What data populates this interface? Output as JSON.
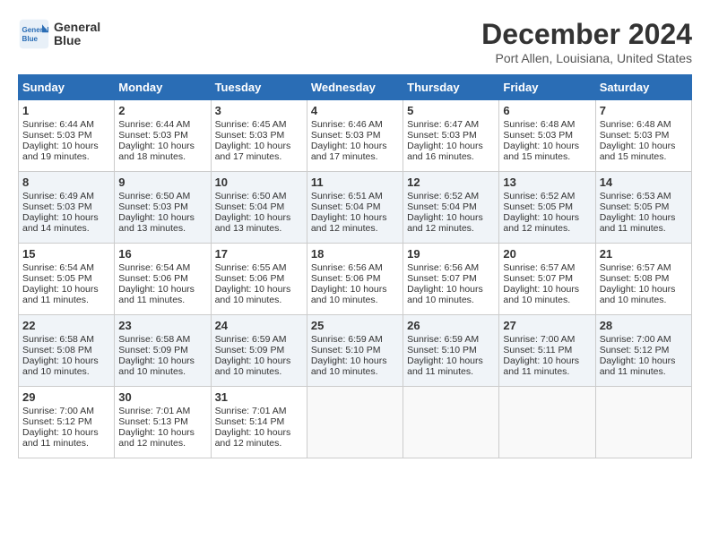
{
  "header": {
    "logo_line1": "General",
    "logo_line2": "Blue",
    "title": "December 2024",
    "subtitle": "Port Allen, Louisiana, United States"
  },
  "calendar": {
    "days_of_week": [
      "Sunday",
      "Monday",
      "Tuesday",
      "Wednesday",
      "Thursday",
      "Friday",
      "Saturday"
    ],
    "weeks": [
      [
        {
          "day": "1",
          "sunrise": "6:44 AM",
          "sunset": "5:03 PM",
          "daylight": "10 hours and 19 minutes."
        },
        {
          "day": "2",
          "sunrise": "6:44 AM",
          "sunset": "5:03 PM",
          "daylight": "10 hours and 18 minutes."
        },
        {
          "day": "3",
          "sunrise": "6:45 AM",
          "sunset": "5:03 PM",
          "daylight": "10 hours and 17 minutes."
        },
        {
          "day": "4",
          "sunrise": "6:46 AM",
          "sunset": "5:03 PM",
          "daylight": "10 hours and 17 minutes."
        },
        {
          "day": "5",
          "sunrise": "6:47 AM",
          "sunset": "5:03 PM",
          "daylight": "10 hours and 16 minutes."
        },
        {
          "day": "6",
          "sunrise": "6:48 AM",
          "sunset": "5:03 PM",
          "daylight": "10 hours and 15 minutes."
        },
        {
          "day": "7",
          "sunrise": "6:48 AM",
          "sunset": "5:03 PM",
          "daylight": "10 hours and 15 minutes."
        }
      ],
      [
        {
          "day": "8",
          "sunrise": "6:49 AM",
          "sunset": "5:03 PM",
          "daylight": "10 hours and 14 minutes."
        },
        {
          "day": "9",
          "sunrise": "6:50 AM",
          "sunset": "5:03 PM",
          "daylight": "10 hours and 13 minutes."
        },
        {
          "day": "10",
          "sunrise": "6:50 AM",
          "sunset": "5:04 PM",
          "daylight": "10 hours and 13 minutes."
        },
        {
          "day": "11",
          "sunrise": "6:51 AM",
          "sunset": "5:04 PM",
          "daylight": "10 hours and 12 minutes."
        },
        {
          "day": "12",
          "sunrise": "6:52 AM",
          "sunset": "5:04 PM",
          "daylight": "10 hours and 12 minutes."
        },
        {
          "day": "13",
          "sunrise": "6:52 AM",
          "sunset": "5:05 PM",
          "daylight": "10 hours and 12 minutes."
        },
        {
          "day": "14",
          "sunrise": "6:53 AM",
          "sunset": "5:05 PM",
          "daylight": "10 hours and 11 minutes."
        }
      ],
      [
        {
          "day": "15",
          "sunrise": "6:54 AM",
          "sunset": "5:05 PM",
          "daylight": "10 hours and 11 minutes."
        },
        {
          "day": "16",
          "sunrise": "6:54 AM",
          "sunset": "5:06 PM",
          "daylight": "10 hours and 11 minutes."
        },
        {
          "day": "17",
          "sunrise": "6:55 AM",
          "sunset": "5:06 PM",
          "daylight": "10 hours and 10 minutes."
        },
        {
          "day": "18",
          "sunrise": "6:56 AM",
          "sunset": "5:06 PM",
          "daylight": "10 hours and 10 minutes."
        },
        {
          "day": "19",
          "sunrise": "6:56 AM",
          "sunset": "5:07 PM",
          "daylight": "10 hours and 10 minutes."
        },
        {
          "day": "20",
          "sunrise": "6:57 AM",
          "sunset": "5:07 PM",
          "daylight": "10 hours and 10 minutes."
        },
        {
          "day": "21",
          "sunrise": "6:57 AM",
          "sunset": "5:08 PM",
          "daylight": "10 hours and 10 minutes."
        }
      ],
      [
        {
          "day": "22",
          "sunrise": "6:58 AM",
          "sunset": "5:08 PM",
          "daylight": "10 hours and 10 minutes."
        },
        {
          "day": "23",
          "sunrise": "6:58 AM",
          "sunset": "5:09 PM",
          "daylight": "10 hours and 10 minutes."
        },
        {
          "day": "24",
          "sunrise": "6:59 AM",
          "sunset": "5:09 PM",
          "daylight": "10 hours and 10 minutes."
        },
        {
          "day": "25",
          "sunrise": "6:59 AM",
          "sunset": "5:10 PM",
          "daylight": "10 hours and 10 minutes."
        },
        {
          "day": "26",
          "sunrise": "6:59 AM",
          "sunset": "5:10 PM",
          "daylight": "10 hours and 11 minutes."
        },
        {
          "day": "27",
          "sunrise": "7:00 AM",
          "sunset": "5:11 PM",
          "daylight": "10 hours and 11 minutes."
        },
        {
          "day": "28",
          "sunrise": "7:00 AM",
          "sunset": "5:12 PM",
          "daylight": "10 hours and 11 minutes."
        }
      ],
      [
        {
          "day": "29",
          "sunrise": "7:00 AM",
          "sunset": "5:12 PM",
          "daylight": "10 hours and 11 minutes."
        },
        {
          "day": "30",
          "sunrise": "7:01 AM",
          "sunset": "5:13 PM",
          "daylight": "10 hours and 12 minutes."
        },
        {
          "day": "31",
          "sunrise": "7:01 AM",
          "sunset": "5:14 PM",
          "daylight": "10 hours and 12 minutes."
        },
        null,
        null,
        null,
        null
      ]
    ]
  }
}
